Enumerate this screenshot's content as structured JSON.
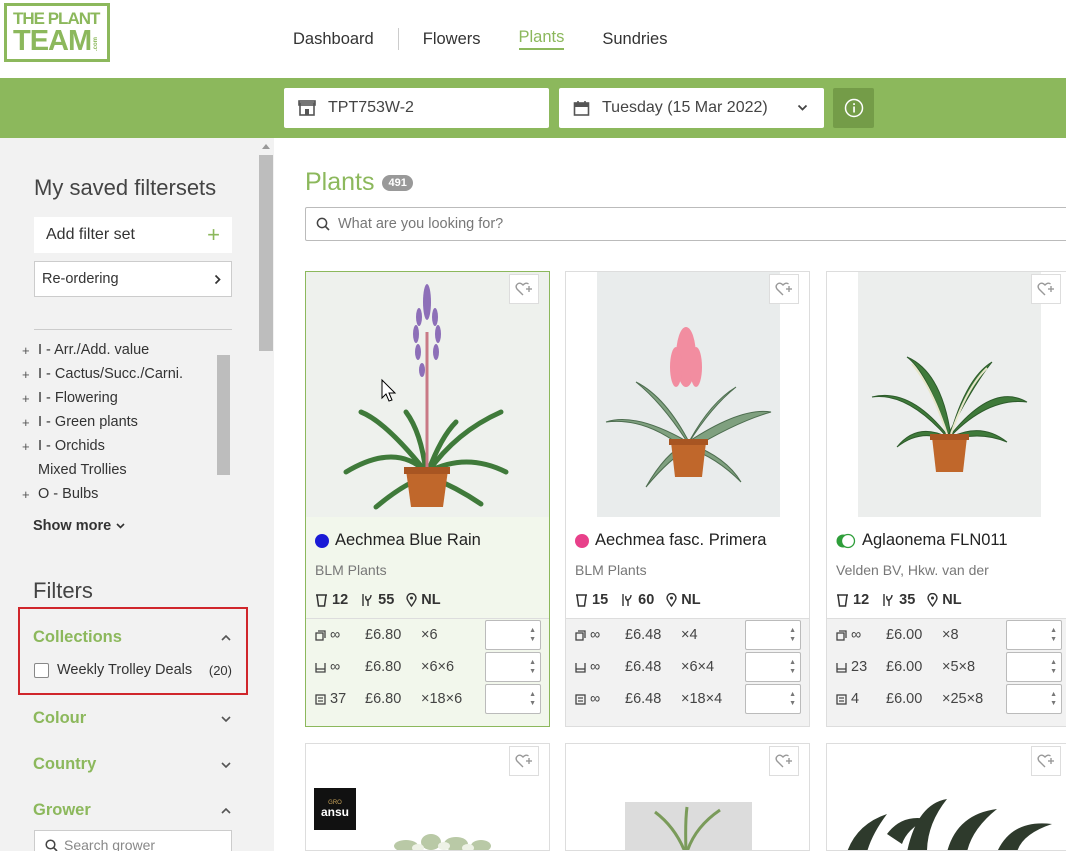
{
  "logo": {
    "line1": "THE PLANT",
    "line2": "TEAM",
    "domain": ".com"
  },
  "nav": {
    "items": [
      "Dashboard",
      "Flowers",
      "Plants",
      "Sundries"
    ],
    "active": "Plants"
  },
  "toolbar": {
    "store": "TPT753W-2",
    "date": "Tuesday (15 Mar 2022)"
  },
  "sidebar": {
    "title": "My saved filtersets",
    "add_label": "Add filter set",
    "reorder_label": "Re-ordering",
    "categories": [
      {
        "prefix": "+",
        "label": "I - Arr./Add. value"
      },
      {
        "prefix": "+",
        "label": "I - Cactus/Succ./Carni."
      },
      {
        "prefix": "+",
        "label": "I - Flowering"
      },
      {
        "prefix": "+",
        "label": "I - Green plants"
      },
      {
        "prefix": "+",
        "label": "I - Orchids"
      },
      {
        "prefix": "",
        "label": "Mixed Trollies"
      },
      {
        "prefix": "+",
        "label": "O - Bulbs"
      }
    ],
    "show_more": "Show more",
    "filters_title": "Filters",
    "sections": {
      "collections": "Collections",
      "colour": "Colour",
      "country": "Country",
      "grower": "Grower"
    },
    "collection_option": {
      "label": "Weekly Trolley Deals",
      "count": "(20)"
    },
    "grower_search_placeholder": "Search grower"
  },
  "main": {
    "title": "Plants",
    "count": "491",
    "search_placeholder": "What are you looking for?"
  },
  "products": [
    {
      "name": "Aechmea Blue Rain",
      "dot_color": "#1a1ad6",
      "grower": "BLM Plants",
      "pot": "12",
      "height": "55",
      "country": "NL",
      "rows": [
        {
          "stock": "∞",
          "price": "£6.80",
          "mult": "×6"
        },
        {
          "stock": "∞",
          "price": "£6.80",
          "mult": "×6×6"
        },
        {
          "stock": "37",
          "price": "£6.80",
          "mult": "×18×6"
        }
      ]
    },
    {
      "name": "Aechmea fasc. Primera",
      "dot_color": "#e8408a",
      "grower": "BLM Plants",
      "pot": "15",
      "height": "60",
      "country": "NL",
      "rows": [
        {
          "stock": "∞",
          "price": "£6.48",
          "mult": "×4"
        },
        {
          "stock": "∞",
          "price": "£6.48",
          "mult": "×6×4"
        },
        {
          "stock": "∞",
          "price": "£6.48",
          "mult": "×18×4"
        }
      ]
    },
    {
      "name": "Aglaonema FLN011",
      "dot_color": "#2e9e3a",
      "grower": "Velden BV, Hkw. van der",
      "pot": "12",
      "height": "35",
      "country": "NL",
      "rows": [
        {
          "stock": "∞",
          "price": "£6.00",
          "mult": "×8"
        },
        {
          "stock": "23",
          "price": "£6.00",
          "mult": "×5×8"
        },
        {
          "stock": "4",
          "price": "£6.00",
          "mult": "×25×8"
        }
      ]
    }
  ],
  "second_row": {
    "brand_badge_top": "GRO",
    "brand_badge": "ansu"
  },
  "colors": {
    "accent": "#8cb85c",
    "highlight": "#d0262b"
  }
}
